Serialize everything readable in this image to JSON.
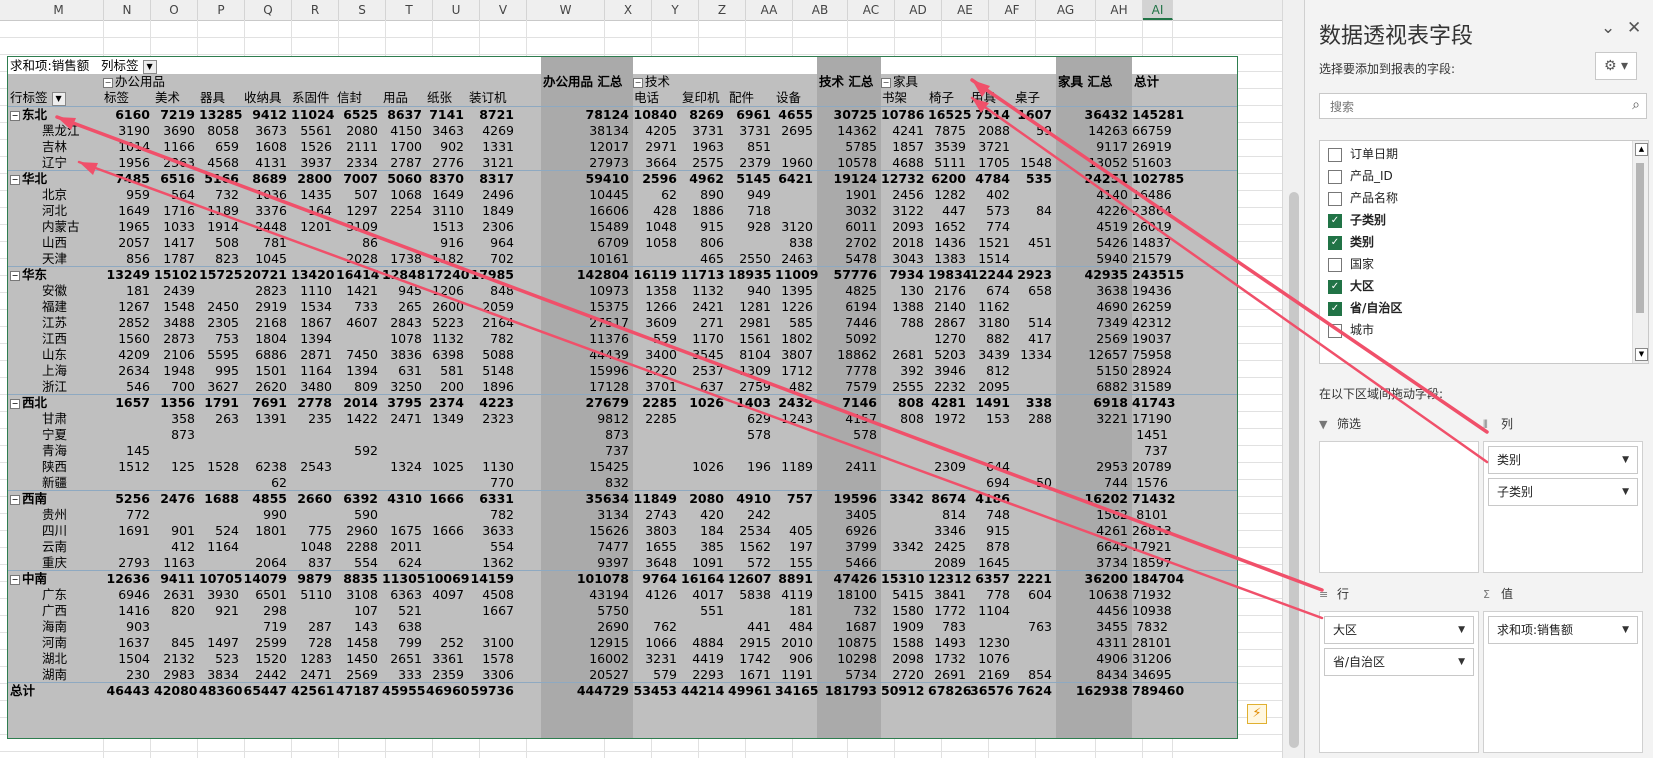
{
  "columns": [
    "M",
    "N",
    "O",
    "P",
    "Q",
    "R",
    "S",
    "T",
    "U",
    "V",
    "W",
    "X",
    "Y",
    "Z",
    "AA",
    "AB",
    "AC",
    "AD",
    "AE",
    "AF",
    "AG",
    "AH",
    "AI"
  ],
  "selected_column": "AI",
  "pivot": {
    "corner_label": "求和项:销售额",
    "col_label_btn": "列标签",
    "row_label_btn": "行标签",
    "categories": {
      "office": "办公用品",
      "tech": "技术",
      "furniture": "家具"
    },
    "subcats": [
      "标签",
      "美术",
      "器具",
      "收纳具",
      "系固件",
      "信封",
      "用品",
      "纸张",
      "装订机",
      "电话",
      "复印机",
      "配件",
      "设备",
      "书架",
      "椅子",
      "用具",
      "桌子"
    ],
    "totals_headers": {
      "office": "办公用品 汇总",
      "tech": "技术 汇总",
      "furniture": "家具 汇总",
      "grand": "总计"
    },
    "rows": [
      {
        "name": "东北",
        "type": "region",
        "v": [
          "6160",
          "7219",
          "13285",
          "9412",
          "11024",
          "6525",
          "8637",
          "7141",
          "8721",
          "78124",
          "10840",
          "8269",
          "6961",
          "4655",
          "30725",
          "10786",
          "16525",
          "7514",
          "1607",
          "36432",
          "145281"
        ]
      },
      {
        "name": "黑龙江",
        "type": "prov",
        "v": [
          "3190",
          "3690",
          "8058",
          "3673",
          "5561",
          "2080",
          "4150",
          "3463",
          "4269",
          "38134",
          "4205",
          "3731",
          "3731",
          "2695",
          "14362",
          "4241",
          "7875",
          "2088",
          "59",
          "14263",
          "66759"
        ]
      },
      {
        "name": "吉林",
        "type": "prov",
        "v": [
          "1014",
          "1166",
          "659",
          "1608",
          "1526",
          "2111",
          "1700",
          "902",
          "1331",
          "12017",
          "2971",
          "1963",
          "851",
          "",
          "5785",
          "1857",
          "3539",
          "3721",
          "",
          "9117",
          "26919"
        ]
      },
      {
        "name": "辽宁",
        "type": "prov",
        "v": [
          "1956",
          "2363",
          "4568",
          "4131",
          "3937",
          "2334",
          "2787",
          "2776",
          "3121",
          "27973",
          "3664",
          "2575",
          "2379",
          "1960",
          "10578",
          "4688",
          "5111",
          "1705",
          "1548",
          "13052",
          "51603"
        ]
      },
      {
        "name": "华北",
        "type": "region",
        "v": [
          "7485",
          "6516",
          "5166",
          "8689",
          "2800",
          "7007",
          "5060",
          "8370",
          "8317",
          "59410",
          "2596",
          "4962",
          "5145",
          "6421",
          "19124",
          "12732",
          "6200",
          "4784",
          "535",
          "24251",
          "102785"
        ]
      },
      {
        "name": "北京",
        "type": "prov",
        "v": [
          "959",
          "564",
          "732",
          "1036",
          "1435",
          "507",
          "1068",
          "1649",
          "2496",
          "10445",
          "62",
          "890",
          "949",
          "",
          "1901",
          "2456",
          "1282",
          "402",
          "",
          "4140",
          "16486"
        ]
      },
      {
        "name": "河北",
        "type": "prov",
        "v": [
          "1649",
          "1716",
          "1189",
          "3376",
          "164",
          "1297",
          "2254",
          "3110",
          "1849",
          "16606",
          "428",
          "1886",
          "718",
          "",
          "3032",
          "3122",
          "447",
          "573",
          "84",
          "4226",
          "23864"
        ]
      },
      {
        "name": "内蒙古",
        "type": "prov",
        "v": [
          "1965",
          "1033",
          "1914",
          "2448",
          "1201",
          "3109",
          "",
          "1513",
          "2306",
          "15489",
          "1048",
          "915",
          "928",
          "3120",
          "6011",
          "2093",
          "1652",
          "774",
          "",
          "4519",
          "26019"
        ]
      },
      {
        "name": "山西",
        "type": "prov",
        "v": [
          "2057",
          "1417",
          "508",
          "781",
          "",
          "86",
          "",
          "916",
          "964",
          "6709",
          "1058",
          "806",
          "",
          "838",
          "2702",
          "2018",
          "1436",
          "1521",
          "451",
          "5426",
          "14837"
        ]
      },
      {
        "name": "天津",
        "type": "prov",
        "v": [
          "856",
          "1787",
          "823",
          "1045",
          "",
          "2028",
          "1738",
          "1182",
          "702",
          "10161",
          "",
          "465",
          "2550",
          "2463",
          "5478",
          "3043",
          "1383",
          "1514",
          "",
          "5940",
          "21579"
        ]
      },
      {
        "name": "华东",
        "type": "region",
        "v": [
          "13249",
          "15102",
          "15725",
          "20721",
          "13420",
          "16414",
          "12848",
          "17240",
          "17985",
          "142804",
          "16119",
          "11713",
          "18935",
          "11009",
          "57776",
          "7934",
          "19834",
          "12244",
          "2923",
          "42935",
          "243515"
        ]
      },
      {
        "name": "安徽",
        "type": "prov",
        "v": [
          "181",
          "2439",
          "",
          "2823",
          "1110",
          "1421",
          "945",
          "1206",
          "848",
          "10973",
          "1358",
          "1132",
          "940",
          "1395",
          "4825",
          "130",
          "2176",
          "674",
          "658",
          "3638",
          "19436"
        ]
      },
      {
        "name": "福建",
        "type": "prov",
        "v": [
          "1267",
          "1548",
          "2450",
          "2919",
          "1534",
          "733",
          "265",
          "2600",
          "2059",
          "15375",
          "1266",
          "2421",
          "1281",
          "1226",
          "6194",
          "1388",
          "2140",
          "1162",
          "",
          "4690",
          "26259"
        ]
      },
      {
        "name": "江苏",
        "type": "prov",
        "v": [
          "2852",
          "3488",
          "2305",
          "2168",
          "1867",
          "4607",
          "2843",
          "5223",
          "2164",
          "27517",
          "3609",
          "271",
          "2981",
          "585",
          "7446",
          "788",
          "2867",
          "3180",
          "514",
          "7349",
          "42312"
        ]
      },
      {
        "name": "江西",
        "type": "prov",
        "v": [
          "1560",
          "2873",
          "753",
          "1804",
          "1394",
          "",
          "1078",
          "1132",
          "782",
          "11376",
          "559",
          "1170",
          "1561",
          "1802",
          "5092",
          "",
          "1270",
          "882",
          "417",
          "2569",
          "19037"
        ]
      },
      {
        "name": "山东",
        "type": "prov",
        "v": [
          "4209",
          "2106",
          "5595",
          "6886",
          "2871",
          "7450",
          "3836",
          "6398",
          "5088",
          "44439",
          "3400",
          "3545",
          "8104",
          "3807",
          "18862",
          "2681",
          "5203",
          "3439",
          "1334",
          "12657",
          "75958"
        ]
      },
      {
        "name": "上海",
        "type": "prov",
        "v": [
          "2634",
          "1948",
          "995",
          "1501",
          "1164",
          "1394",
          "631",
          "581",
          "5148",
          "15996",
          "2220",
          "2537",
          "1309",
          "1712",
          "7778",
          "392",
          "3946",
          "812",
          "",
          "5150",
          "28924"
        ]
      },
      {
        "name": "浙江",
        "type": "prov",
        "v": [
          "546",
          "700",
          "3627",
          "2620",
          "3480",
          "809",
          "3250",
          "200",
          "1896",
          "17128",
          "3701",
          "637",
          "2759",
          "482",
          "7579",
          "2555",
          "2232",
          "2095",
          "",
          "6882",
          "31589"
        ]
      },
      {
        "name": "西北",
        "type": "region",
        "v": [
          "1657",
          "1356",
          "1791",
          "7691",
          "2778",
          "2014",
          "3795",
          "2374",
          "4223",
          "27679",
          "2285",
          "1026",
          "1403",
          "2432",
          "7146",
          "808",
          "4281",
          "1491",
          "338",
          "6918",
          "41743"
        ]
      },
      {
        "name": "甘肃",
        "type": "prov",
        "v": [
          "",
          "358",
          "263",
          "1391",
          "235",
          "1422",
          "2471",
          "1349",
          "2323",
          "9812",
          "2285",
          "",
          "629",
          "1243",
          "4157",
          "808",
          "1972",
          "153",
          "288",
          "3221",
          "17190"
        ]
      },
      {
        "name": "宁夏",
        "type": "prov",
        "v": [
          "",
          "873",
          "",
          "",
          "",
          "",
          "",
          "",
          "",
          "873",
          "",
          "",
          "578",
          "",
          "578",
          "",
          "",
          "",
          "",
          "",
          "1451"
        ]
      },
      {
        "name": "青海",
        "type": "prov",
        "v": [
          "145",
          "",
          "",
          "",
          "",
          "592",
          "",
          "",
          "",
          "737",
          "",
          "",
          "",
          "",
          "",
          "",
          "",
          "",
          "",
          "",
          "737"
        ]
      },
      {
        "name": "陕西",
        "type": "prov",
        "v": [
          "1512",
          "125",
          "1528",
          "6238",
          "2543",
          "",
          "1324",
          "1025",
          "1130",
          "15425",
          "",
          "1026",
          "196",
          "1189",
          "2411",
          "",
          "2309",
          "644",
          "",
          "2953",
          "20789"
        ]
      },
      {
        "name": "新疆",
        "type": "prov",
        "v": [
          "",
          "",
          "",
          "62",
          "",
          "",
          "",
          "",
          "770",
          "832",
          "",
          "",
          "",
          "",
          "",
          "",
          "",
          "694",
          "50",
          "744",
          "1576"
        ]
      },
      {
        "name": "西南",
        "type": "region",
        "v": [
          "5256",
          "2476",
          "1688",
          "4855",
          "2660",
          "6392",
          "4310",
          "1666",
          "6331",
          "35634",
          "11849",
          "2080",
          "4910",
          "757",
          "19596",
          "3342",
          "8674",
          "4186",
          "",
          "16202",
          "71432"
        ]
      },
      {
        "name": "贵州",
        "type": "prov",
        "v": [
          "772",
          "",
          "",
          "990",
          "",
          "590",
          "",
          "",
          "782",
          "3134",
          "2743",
          "420",
          "242",
          "",
          "3405",
          "",
          "814",
          "748",
          "",
          "1562",
          "8101"
        ]
      },
      {
        "name": "四川",
        "type": "prov",
        "v": [
          "1691",
          "901",
          "524",
          "1801",
          "775",
          "2960",
          "1675",
          "1666",
          "3633",
          "15626",
          "3803",
          "184",
          "2534",
          "405",
          "6926",
          "",
          "3346",
          "915",
          "",
          "4261",
          "26813"
        ]
      },
      {
        "name": "云南",
        "type": "prov",
        "v": [
          "",
          "412",
          "1164",
          "",
          "1048",
          "2288",
          "2011",
          "",
          "554",
          "7477",
          "1655",
          "385",
          "1562",
          "197",
          "3799",
          "3342",
          "2425",
          "878",
          "",
          "6645",
          "17921"
        ]
      },
      {
        "name": "重庆",
        "type": "prov",
        "v": [
          "2793",
          "1163",
          "",
          "2064",
          "837",
          "554",
          "624",
          "",
          "1362",
          "9397",
          "3648",
          "1091",
          "572",
          "155",
          "5466",
          "",
          "2089",
          "1645",
          "",
          "3734",
          "18597"
        ]
      },
      {
        "name": "中南",
        "type": "region",
        "v": [
          "12636",
          "9411",
          "10705",
          "14079",
          "9879",
          "8835",
          "11305",
          "10069",
          "14159",
          "101078",
          "9764",
          "16164",
          "12607",
          "8891",
          "47426",
          "15310",
          "12312",
          "6357",
          "2221",
          "36200",
          "184704"
        ]
      },
      {
        "name": "广东",
        "type": "prov",
        "v": [
          "6946",
          "2631",
          "3930",
          "6501",
          "5110",
          "3108",
          "6363",
          "4097",
          "4508",
          "43194",
          "4126",
          "4017",
          "5838",
          "4119",
          "18100",
          "5415",
          "3841",
          "778",
          "604",
          "10638",
          "71932"
        ]
      },
      {
        "name": "广西",
        "type": "prov",
        "v": [
          "1416",
          "820",
          "921",
          "298",
          "",
          "107",
          "521",
          "",
          "1667",
          "5750",
          "",
          "551",
          "",
          "181",
          "732",
          "1580",
          "1772",
          "1104",
          "",
          "4456",
          "10938"
        ]
      },
      {
        "name": "海南",
        "type": "prov",
        "v": [
          "903",
          "",
          "",
          "719",
          "287",
          "143",
          "638",
          "",
          "",
          "2690",
          "762",
          "",
          "441",
          "484",
          "1687",
          "1909",
          "783",
          "",
          "763",
          "3455",
          "7832"
        ]
      },
      {
        "name": "河南",
        "type": "prov",
        "v": [
          "1637",
          "845",
          "1497",
          "2599",
          "728",
          "1458",
          "799",
          "252",
          "3100",
          "12915",
          "1066",
          "4884",
          "2915",
          "2010",
          "10875",
          "1588",
          "1493",
          "1230",
          "",
          "4311",
          "28101"
        ]
      },
      {
        "name": "湖北",
        "type": "prov",
        "v": [
          "1504",
          "2132",
          "523",
          "1520",
          "1283",
          "1450",
          "2651",
          "3361",
          "1578",
          "16002",
          "3231",
          "4419",
          "1742",
          "906",
          "10298",
          "2098",
          "1732",
          "1076",
          "",
          "4906",
          "31206"
        ]
      },
      {
        "name": "湖南",
        "type": "prov",
        "v": [
          "230",
          "2983",
          "3834",
          "2442",
          "2471",
          "2569",
          "333",
          "2359",
          "3306",
          "20527",
          "579",
          "2293",
          "1671",
          "1191",
          "5734",
          "2720",
          "2691",
          "2169",
          "854",
          "8434",
          "34695"
        ]
      },
      {
        "name": "总计",
        "type": "total",
        "v": [
          "46443",
          "42080",
          "48360",
          "65447",
          "42561",
          "47187",
          "45955",
          "46960",
          "59736",
          "444729",
          "53453",
          "44214",
          "49961",
          "34165",
          "181793",
          "50912",
          "67826",
          "36576",
          "7624",
          "162938",
          "789460"
        ]
      }
    ]
  },
  "task_pane": {
    "title": "数据透视表字段",
    "subtitle": "选择要添加到报表的字段:",
    "gear_icon": "gear-icon",
    "search_placeholder": "搜索",
    "fields": [
      {
        "label": "订单日期",
        "checked": false
      },
      {
        "label": "产品_ID",
        "checked": false
      },
      {
        "label": "产品名称",
        "checked": false
      },
      {
        "label": "子类别",
        "checked": true
      },
      {
        "label": "类别",
        "checked": true
      },
      {
        "label": "国家",
        "checked": false
      },
      {
        "label": "大区",
        "checked": true
      },
      {
        "label": "省/自治区",
        "checked": true
      },
      {
        "label": "城市",
        "checked": false
      }
    ],
    "drag_label": "在以下区域间拖动字段:",
    "areas": {
      "filter": {
        "title": "筛选",
        "items": []
      },
      "columns": {
        "title": "列",
        "items": [
          "类别",
          "子类别"
        ]
      },
      "rows": {
        "title": "行",
        "items": [
          "大区",
          "省/自治区"
        ]
      },
      "values": {
        "title": "值",
        "items": [
          "求和项:销售额"
        ]
      }
    }
  },
  "colors": {
    "accent": "#217346",
    "arrow": "#f0506a",
    "shade": "#aaaaaa",
    "band": "#bfbfbf"
  }
}
